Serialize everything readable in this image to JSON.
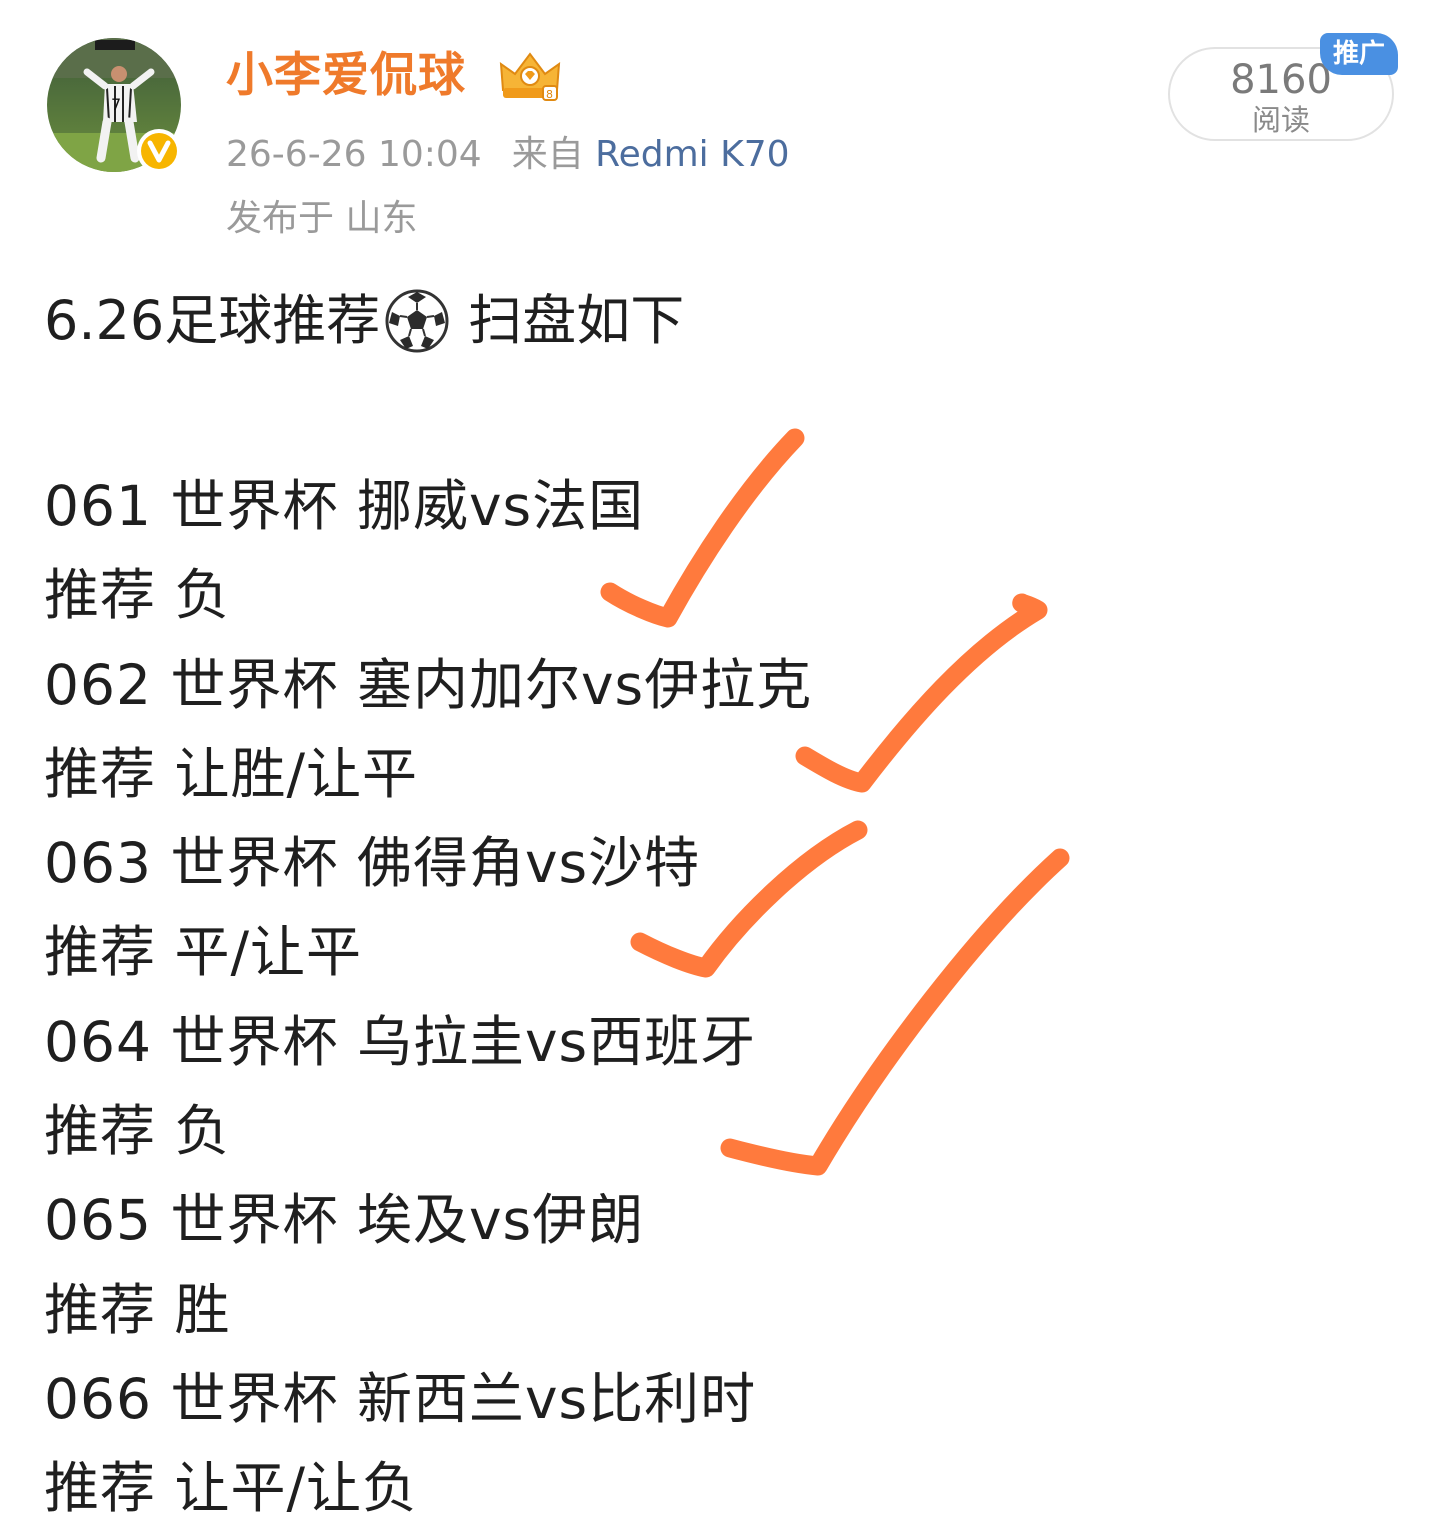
{
  "header": {
    "username": "小李爱侃球",
    "timestamp": "26-6-26 10:04",
    "source_prefix": "来自",
    "device": "Redmi K70",
    "location": "发布于 山东",
    "avatar_icon": "player-avatar-icon",
    "verified_icon": "verified-v-badge-icon",
    "crown_icon": "crown-badge-icon",
    "username_color": "#ef7a2b",
    "device_color": "#4c6d9e"
  },
  "stats": {
    "read_count": "8160",
    "read_label": "阅读",
    "promo_tag": "推广",
    "promo_color": "#4a90e2"
  },
  "post": {
    "title_prefix": "6.26足球推荐",
    "title_emoji": "soccer-ball-icon",
    "title_suffix": "扫盘如下",
    "lines": [
      "061 世界杯 挪威vs法国",
      "推荐 负",
      "062 世界杯 塞内加尔vs伊拉克",
      "推荐 让胜/让平",
      "063 世界杯 佛得角vs沙特",
      "推荐 平/让平",
      "064 世界杯 乌拉圭vs西班牙",
      "推荐 负",
      "065 世界杯 埃及vs伊朗",
      "推荐 胜",
      "066 世界杯 新西兰vs比利时",
      "推荐 让平/让负"
    ],
    "checkmark_icon": "orange-checkmark-icon",
    "checkmark_color": "#ff7a3d"
  }
}
